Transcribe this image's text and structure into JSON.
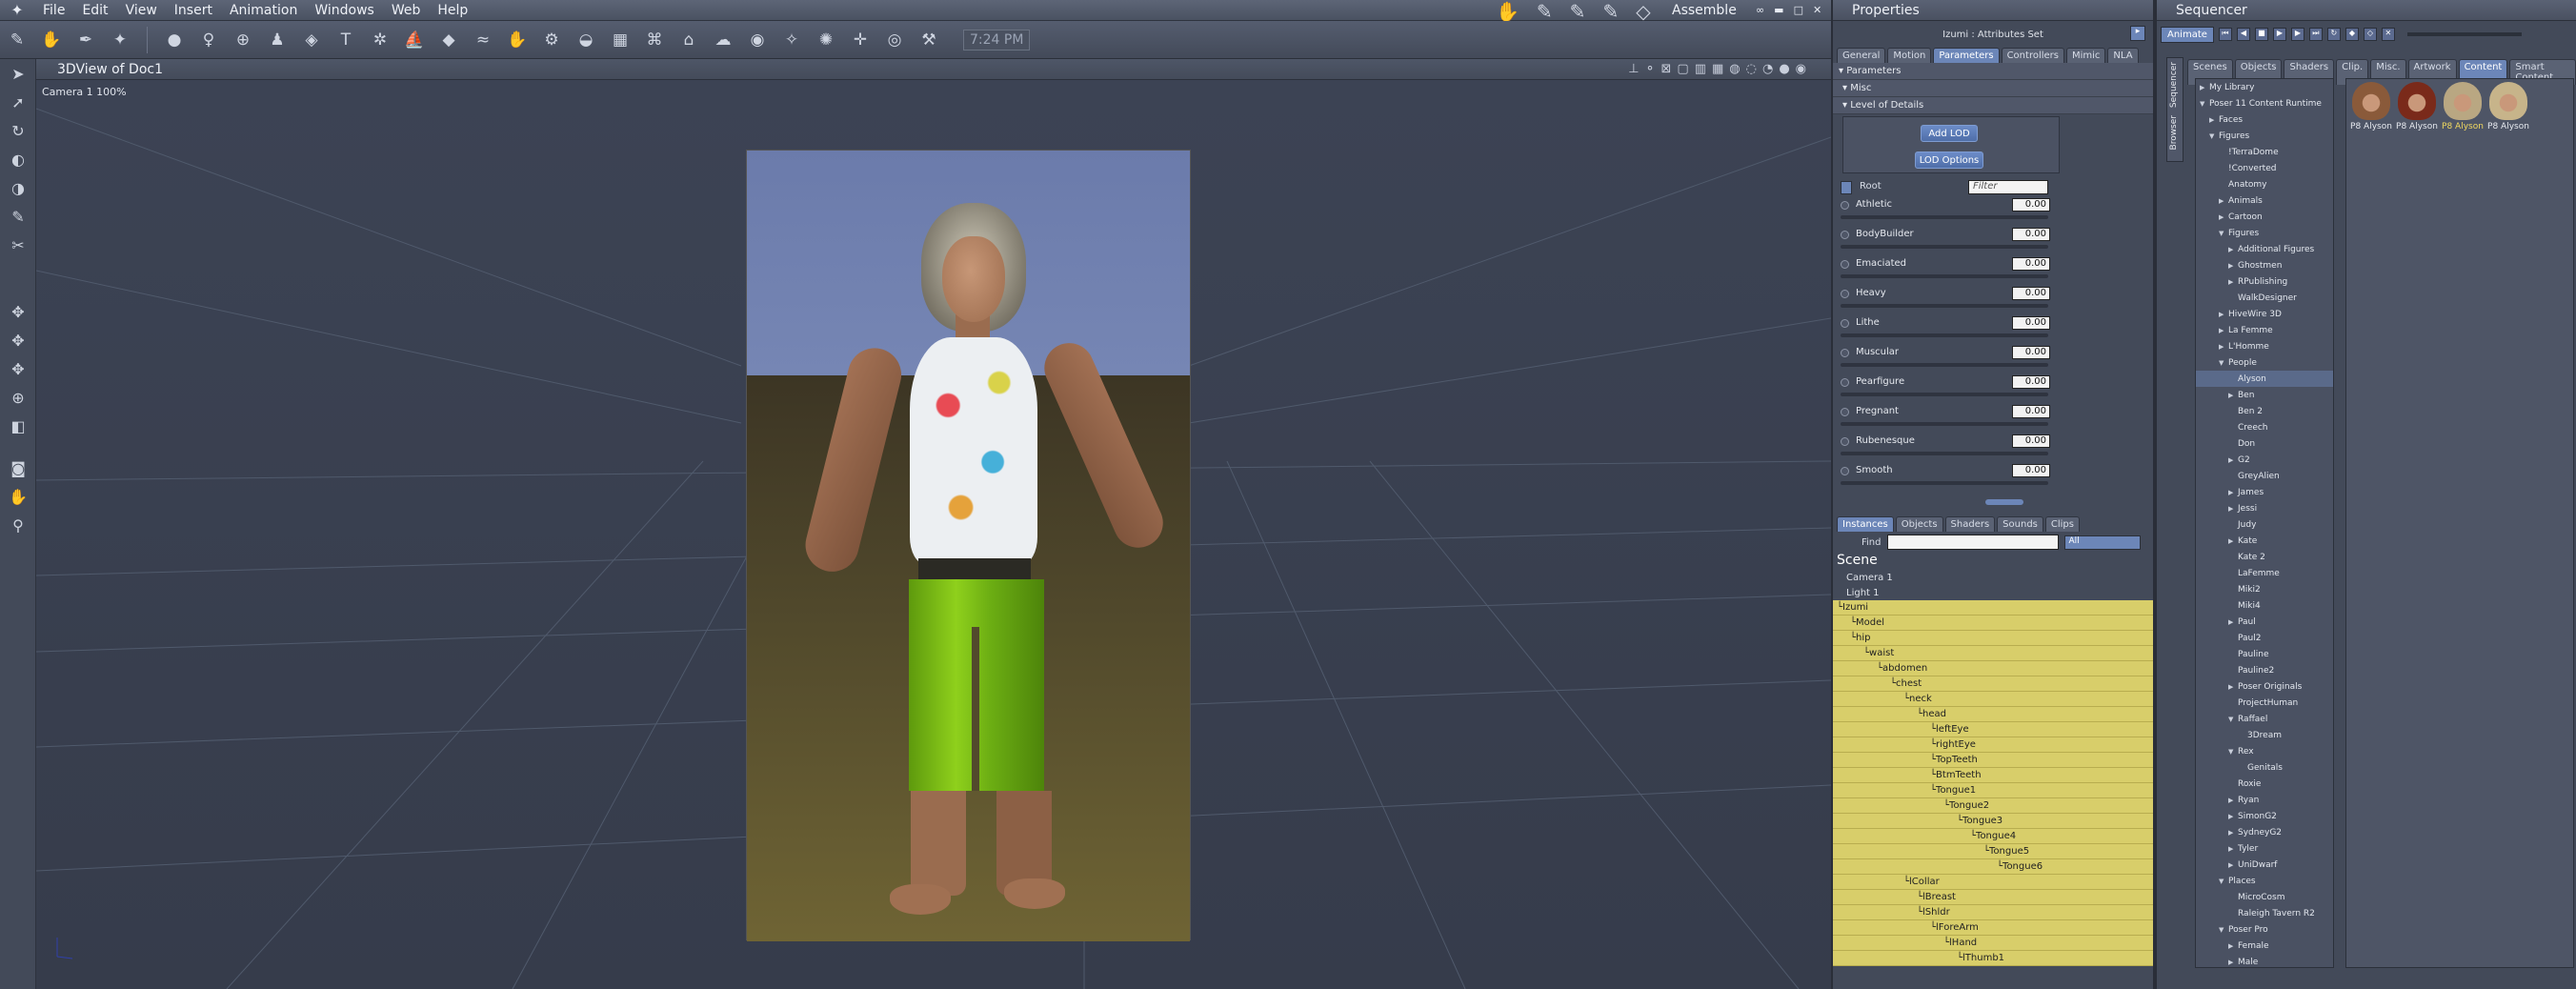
{
  "menu": {
    "items": [
      "File",
      "Edit",
      "View",
      "Insert",
      "Animation",
      "Windows",
      "Web",
      "Help"
    ],
    "room": "Assemble"
  },
  "toolbar": {
    "clock": "7:24 PM"
  },
  "viewport": {
    "title": "3DView of Doc1",
    "camera_label": "Camera 1 100%"
  },
  "properties": {
    "title": "Properties",
    "attr_set": "Izumi : Attributes Set",
    "tabs": [
      "General",
      "Motion",
      "Parameters",
      "Controllers",
      "Mimic",
      "NLA"
    ],
    "active_tab": "Parameters",
    "sections": {
      "parameters": "Parameters",
      "misc": "Misc",
      "lod": "Level of Details"
    },
    "buttons": {
      "add_lod": "Add LOD",
      "lod_options": "LOD Options"
    },
    "root_label": "Root",
    "filter_placeholder": "Filter",
    "dials": [
      {
        "name": "Athletic",
        "value": "0.00"
      },
      {
        "name": "BodyBuilder",
        "value": "0.00"
      },
      {
        "name": "Emaciated",
        "value": "0.00"
      },
      {
        "name": "Heavy",
        "value": "0.00"
      },
      {
        "name": "Lithe",
        "value": "0.00"
      },
      {
        "name": "Muscular",
        "value": "0.00"
      },
      {
        "name": "Pearfigure",
        "value": "0.00"
      },
      {
        "name": "Pregnant",
        "value": "0.00"
      },
      {
        "name": "Rubenesque",
        "value": "0.00"
      },
      {
        "name": "Smooth",
        "value": "0.00"
      }
    ]
  },
  "scene_panel": {
    "tabs": [
      "Instances",
      "Objects",
      "Shaders",
      "Sounds",
      "Clips"
    ],
    "find_label": "Find",
    "filter_select": "All",
    "scene_label": "Scene",
    "plain_items": [
      "Camera 1",
      "Light 1"
    ],
    "hierarchy": [
      {
        "label": "Izumi",
        "depth": 0
      },
      {
        "label": "Model",
        "depth": 1
      },
      {
        "label": "hip",
        "depth": 1
      },
      {
        "label": "waist",
        "depth": 2
      },
      {
        "label": "abdomen",
        "depth": 3
      },
      {
        "label": "chest",
        "depth": 4
      },
      {
        "label": "neck",
        "depth": 5
      },
      {
        "label": "head",
        "depth": 6
      },
      {
        "label": "leftEye",
        "depth": 7
      },
      {
        "label": "rightEye",
        "depth": 7
      },
      {
        "label": "TopTeeth",
        "depth": 7
      },
      {
        "label": "BtmTeeth",
        "depth": 7
      },
      {
        "label": "Tongue1",
        "depth": 7
      },
      {
        "label": "Tongue2",
        "depth": 8
      },
      {
        "label": "Tongue3",
        "depth": 9
      },
      {
        "label": "Tongue4",
        "depth": 10
      },
      {
        "label": "Tongue5",
        "depth": 11
      },
      {
        "label": "Tongue6",
        "depth": 12
      },
      {
        "label": "lCollar",
        "depth": 5
      },
      {
        "label": "lBreast",
        "depth": 6
      },
      {
        "label": "lShldr",
        "depth": 6
      },
      {
        "label": "lForeArm",
        "depth": 7
      },
      {
        "label": "lHand",
        "depth": 8
      },
      {
        "label": "lThumb1",
        "depth": 9
      }
    ]
  },
  "sequencer": {
    "title": "Sequencer",
    "animate_button": "Animate",
    "side_tabs": [
      "Sequencer",
      "Browser"
    ],
    "lib_tabs": [
      "Scenes",
      "Objects",
      "Shaders",
      "Clip.",
      "Misc.",
      "Artwork",
      "Content",
      "Smart Content"
    ],
    "active_lib_tab": "Content",
    "tree": [
      {
        "label": "My Library",
        "depth": 0,
        "arrow": "right"
      },
      {
        "label": "Poser 11 Content Runtime",
        "depth": 0,
        "arrow": "down"
      },
      {
        "label": "Faces",
        "depth": 1,
        "arrow": "right"
      },
      {
        "label": "Figures",
        "depth": 1,
        "arrow": "down"
      },
      {
        "label": "!TerraDome",
        "depth": 2,
        "arrow": ""
      },
      {
        "label": "!Converted",
        "depth": 2,
        "arrow": ""
      },
      {
        "label": "Anatomy",
        "depth": 2,
        "arrow": ""
      },
      {
        "label": "Animals",
        "depth": 2,
        "arrow": "right"
      },
      {
        "label": "Cartoon",
        "depth": 2,
        "arrow": "right"
      },
      {
        "label": "Figures",
        "depth": 2,
        "arrow": "down"
      },
      {
        "label": "Additional Figures",
        "depth": 3,
        "arrow": "right"
      },
      {
        "label": "Ghostmen",
        "depth": 3,
        "arrow": "right"
      },
      {
        "label": "RPublishing",
        "depth": 3,
        "arrow": "right"
      },
      {
        "label": "WalkDesigner",
        "depth": 3,
        "arrow": ""
      },
      {
        "label": "HiveWire 3D",
        "depth": 2,
        "arrow": "right"
      },
      {
        "label": "La Femme",
        "depth": 2,
        "arrow": "right"
      },
      {
        "label": "L'Homme",
        "depth": 2,
        "arrow": "right"
      },
      {
        "label": "People",
        "depth": 2,
        "arrow": "down"
      },
      {
        "label": "Alyson",
        "depth": 3,
        "arrow": "",
        "selected": true
      },
      {
        "label": "Ben",
        "depth": 3,
        "arrow": "right"
      },
      {
        "label": "Ben 2",
        "depth": 3,
        "arrow": ""
      },
      {
        "label": "Creech",
        "depth": 3,
        "arrow": ""
      },
      {
        "label": "Don",
        "depth": 3,
        "arrow": ""
      },
      {
        "label": "G2",
        "depth": 3,
        "arrow": "right"
      },
      {
        "label": "GreyAlien",
        "depth": 3,
        "arrow": ""
      },
      {
        "label": "James",
        "depth": 3,
        "arrow": "right"
      },
      {
        "label": "Jessi",
        "depth": 3,
        "arrow": "right"
      },
      {
        "label": "Judy",
        "depth": 3,
        "arrow": ""
      },
      {
        "label": "Kate",
        "depth": 3,
        "arrow": "right"
      },
      {
        "label": "Kate 2",
        "depth": 3,
        "arrow": ""
      },
      {
        "label": "LaFemme",
        "depth": 3,
        "arrow": ""
      },
      {
        "label": "Miki2",
        "depth": 3,
        "arrow": ""
      },
      {
        "label": "Miki4",
        "depth": 3,
        "arrow": ""
      },
      {
        "label": "Paul",
        "depth": 3,
        "arrow": "right"
      },
      {
        "label": "Paul2",
        "depth": 3,
        "arrow": ""
      },
      {
        "label": "Pauline",
        "depth": 3,
        "arrow": ""
      },
      {
        "label": "Pauline2",
        "depth": 3,
        "arrow": ""
      },
      {
        "label": "Poser Originals",
        "depth": 3,
        "arrow": "right"
      },
      {
        "label": "ProjectHuman",
        "depth": 3,
        "arrow": ""
      },
      {
        "label": "Raffael",
        "depth": 3,
        "arrow": "down"
      },
      {
        "label": "3Dream",
        "depth": 4,
        "arrow": ""
      },
      {
        "label": "Rex",
        "depth": 3,
        "arrow": "down"
      },
      {
        "label": "Genitals",
        "depth": 4,
        "arrow": ""
      },
      {
        "label": "Roxie",
        "depth": 3,
        "arrow": ""
      },
      {
        "label": "Ryan",
        "depth": 3,
        "arrow": "right"
      },
      {
        "label": "SimonG2",
        "depth": 3,
        "arrow": "right"
      },
      {
        "label": "SydneyG2",
        "depth": 3,
        "arrow": "right"
      },
      {
        "label": "Tyler",
        "depth": 3,
        "arrow": "right"
      },
      {
        "label": "UniDwarf",
        "depth": 3,
        "arrow": "right"
      },
      {
        "label": "Places",
        "depth": 2,
        "arrow": "down"
      },
      {
        "label": "MicroCosm",
        "depth": 3,
        "arrow": ""
      },
      {
        "label": "Raleigh Tavern R2",
        "depth": 3,
        "arrow": ""
      },
      {
        "label": "Poser Pro",
        "depth": 2,
        "arrow": "down"
      },
      {
        "label": "Female",
        "depth": 3,
        "arrow": "right"
      },
      {
        "label": "Male",
        "depth": 3,
        "arrow": "right"
      }
    ],
    "thumbnails": [
      {
        "label": "P8 Alyson",
        "color": "#8a5a3a"
      },
      {
        "label": "P8 Alyson",
        "color": "#7a2a1a"
      },
      {
        "label": "P8 Alyson",
        "color": "#b9a782",
        "selected": true
      },
      {
        "label": "P8 Alyson",
        "color": "#c7b48a"
      }
    ]
  }
}
